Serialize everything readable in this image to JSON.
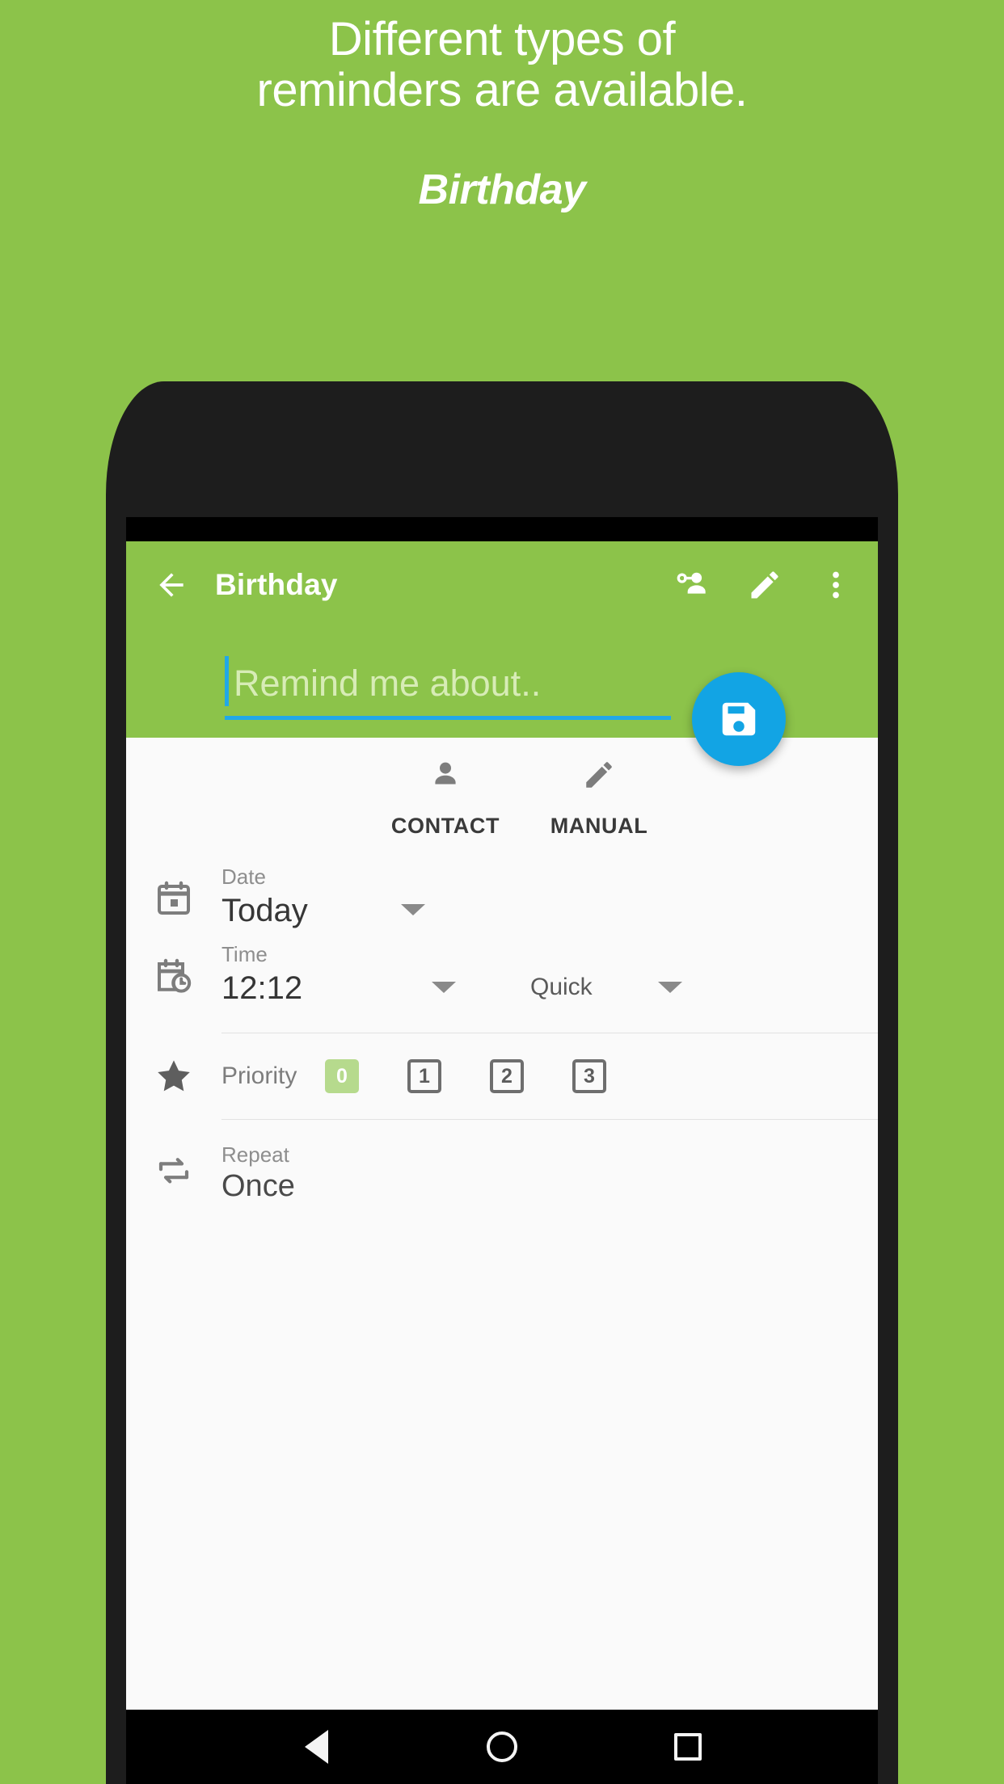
{
  "promo": {
    "headline_line1": "Different types of",
    "headline_line2": "reminders are available.",
    "subtitle": "Birthday",
    "background_color": "#8cc34a",
    "text_color": "#ffffff"
  },
  "app": {
    "toolbar": {
      "back_icon": "arrow-left-icon",
      "title": "Birthday",
      "actions": [
        {
          "icon": "person-add-icon",
          "name": "add-contact-button"
        },
        {
          "icon": "pencil-icon",
          "name": "edit-button"
        },
        {
          "icon": "overflow-menu-icon",
          "name": "overflow-menu-button"
        }
      ]
    },
    "title_input": {
      "value": "",
      "placeholder": "Remind me about..",
      "caret_color": "#21a8e8",
      "underline_color": "#21a8e8"
    },
    "fab": {
      "icon": "save-floppy-icon",
      "label": "Save",
      "color": "#12a4e4"
    },
    "tabs": [
      {
        "label": "CONTACT",
        "icon": "person-icon",
        "selected": false
      },
      {
        "label": "MANUAL",
        "icon": "pencil-icon",
        "selected": false
      }
    ],
    "fields": {
      "date": {
        "label": "Date",
        "value": "Today",
        "icon": "calendar-icon",
        "dropdown": "chevron-down-icon"
      },
      "time": {
        "label": "Time",
        "value": "12:12",
        "icon": "calendar-clock-icon",
        "dropdown": "chevron-down-icon",
        "quick_label": "Quick",
        "quick_dropdown": "chevron-down-icon"
      },
      "priority": {
        "label": "Priority",
        "icon": "star-icon",
        "options": [
          "0",
          "1",
          "2",
          "3"
        ],
        "selected": "0",
        "selected_color": "#b6da8d"
      },
      "repeat": {
        "label": "Repeat",
        "value": "Once",
        "icon": "repeat-icon"
      }
    },
    "navbar": {
      "back": "triangle-back-icon",
      "home": "circle-home-icon",
      "recents": "square-recents-icon"
    }
  }
}
